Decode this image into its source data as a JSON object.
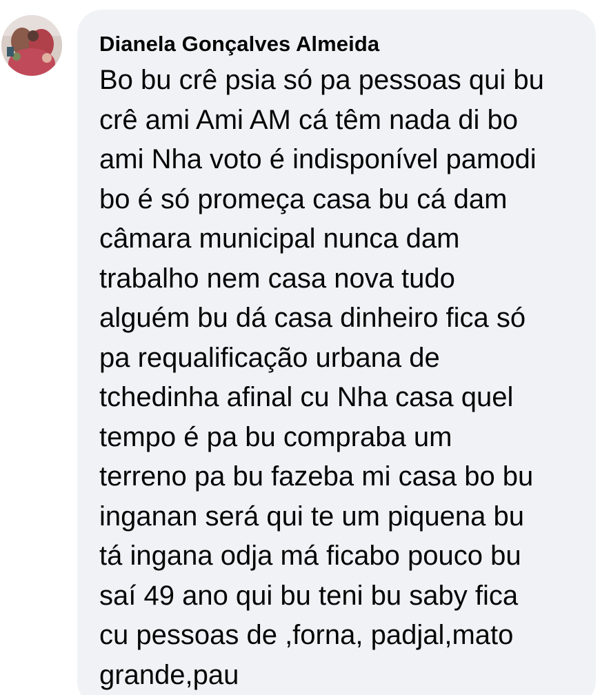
{
  "comment": {
    "author": "Dianela Gonçalves Almeida",
    "avatar_icon": "profile-photo-avatar",
    "bubble_color": "#f0f2f5",
    "text_lines": [
      "Bo bu crê psia só pa pessoas qui bu",
      "crê ami Ami AM cá têm nada di bo",
      "ami Nha voto é indisponível pamodi",
      "bo é só promeça casa bu cá dam",
      "câmara municipal nunca dam",
      "trabalho nem casa nova tudo",
      "alguém bu dá casa dinheiro fica só",
      "pa requalificação urbana de",
      "tchedinha afinal cu Nha casa quel",
      "tempo é pa bu compraba um",
      "terreno pa bu fazeba mi casa bo bu",
      "inganan será qui te um piquena bu",
      "tá ingana odja má ficabo pouco bu",
      "saí 49 ano qui bu teni bu saby fica",
      "cu pessoas de ,forna, padjal,mato",
      "grande,pau"
    ]
  }
}
